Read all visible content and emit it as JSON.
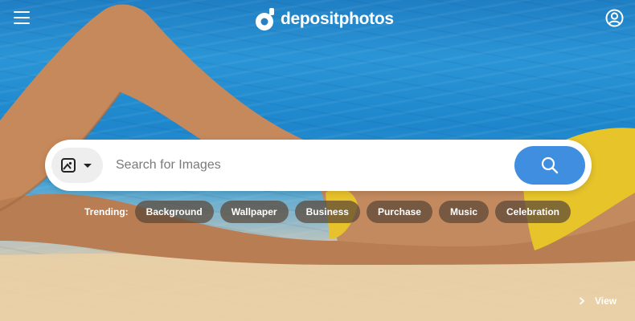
{
  "header": {
    "brand": "depositphotos",
    "menu_icon": "hamburger-menu-icon",
    "account_icon": "user-account-icon"
  },
  "search": {
    "placeholder": "Search for Images",
    "value": "",
    "type_icon": "image-type-icon",
    "button_icon": "search-icon"
  },
  "trending": {
    "label": "Trending:",
    "tags": [
      "Background",
      "Wallpaper",
      "Business",
      "Purchase",
      "Music",
      "Celebration"
    ]
  },
  "footer": {
    "view_label": "View"
  },
  "colors": {
    "accent": "#3f8ee0",
    "chip_bg": "#5a4637",
    "text_on_dark": "#ffffff"
  }
}
